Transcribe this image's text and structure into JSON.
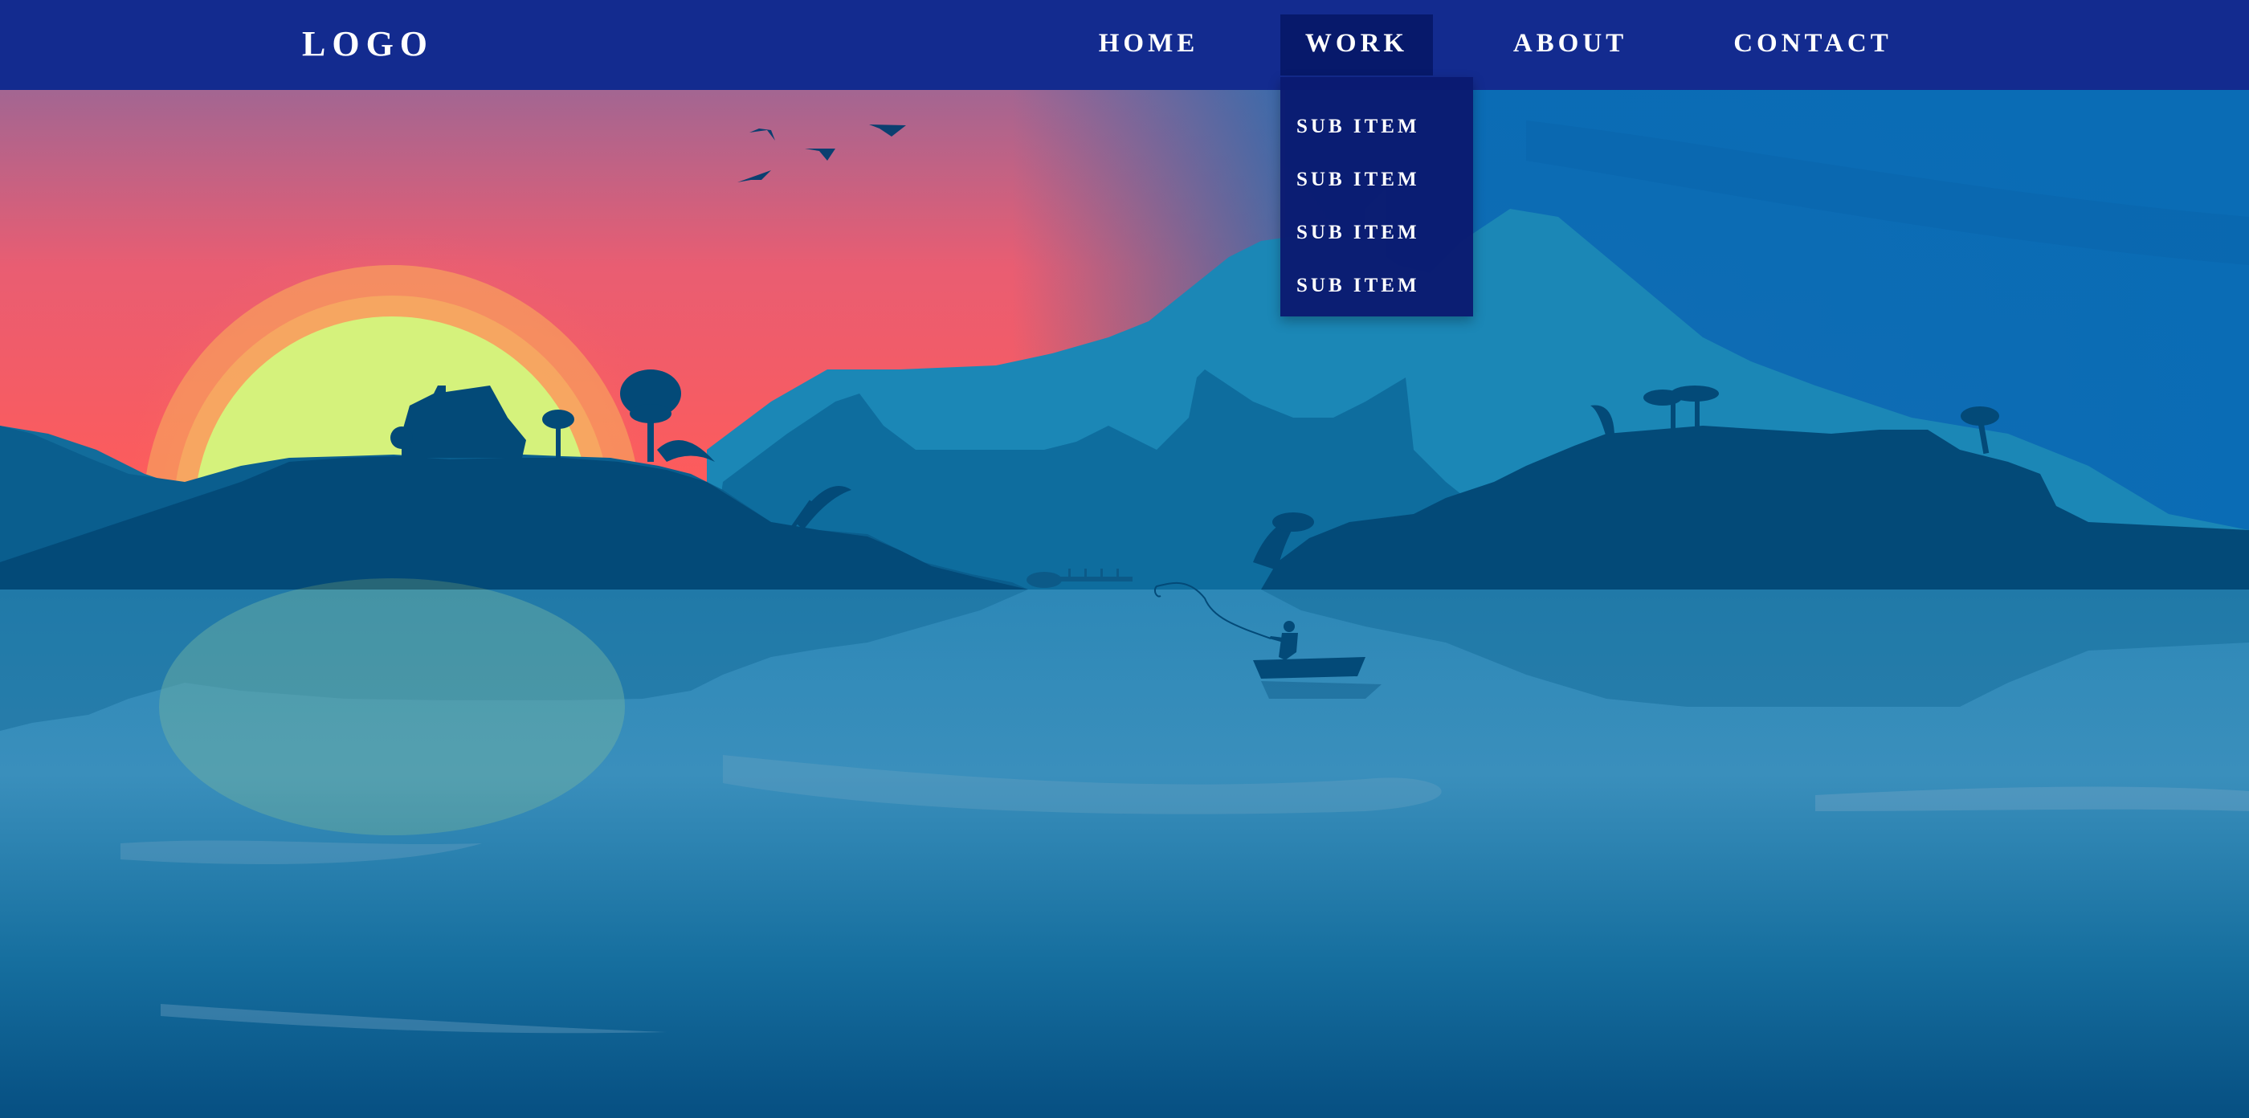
{
  "brand": {
    "logo": "LOGO"
  },
  "nav": {
    "items": [
      {
        "label": "HOME",
        "active": false
      },
      {
        "label": "WORK",
        "active": true
      },
      {
        "label": "ABOUT",
        "active": false
      },
      {
        "label": "CONTACT",
        "active": false
      }
    ],
    "dropdown": {
      "parent": "WORK",
      "items": [
        {
          "label": "SUB ITEM"
        },
        {
          "label": "SUB ITEM"
        },
        {
          "label": "SUB ITEM"
        },
        {
          "label": "SUB ITEM"
        }
      ]
    }
  },
  "colors": {
    "nav_bg": "#132b8f",
    "nav_active_bg": "#07196b",
    "dropdown_bg": "#0a1a70",
    "sky_top": "#0a6cb5",
    "sky_sunset": "#ff5a5a",
    "sun": "#d5f27c",
    "silhouette": "#034a78",
    "water": "#1d7aa8"
  },
  "scene": {
    "description_icons": [
      "sun-icon",
      "house-icon",
      "palm-tree-icon",
      "bird-icon",
      "boat-icon",
      "fisherman-icon"
    ]
  }
}
